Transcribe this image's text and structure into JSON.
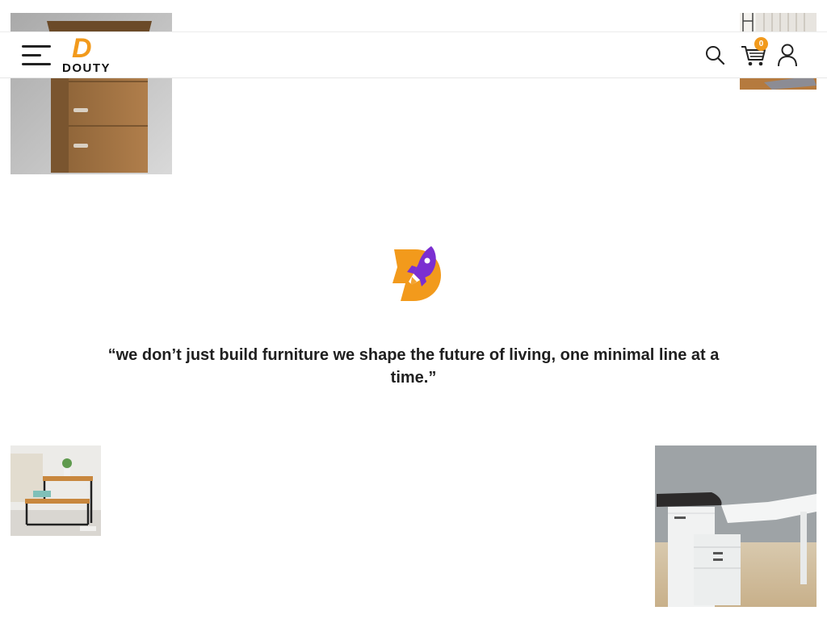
{
  "brand": {
    "logo_letter": "D",
    "logo_word": "DOUTY",
    "accent_color": "#f29a1c",
    "badge_color": "#7b2fd1"
  },
  "header": {
    "menu_icon": "hamburger-icon",
    "search_icon": "search-icon",
    "cart_icon": "cart-icon",
    "cart_count": "0",
    "account_icon": "user-icon"
  },
  "main": {
    "badge_icon": "rocket-icon",
    "quote": "“we don’t just build furniture we shape the future of living, one minimal line at a time.”"
  },
  "images": [
    {
      "name": "wooden-drawer-cabinet"
    },
    {
      "name": "shelf-with-rug"
    },
    {
      "name": "two-tier-side-table"
    },
    {
      "name": "white-corner-desk"
    }
  ]
}
